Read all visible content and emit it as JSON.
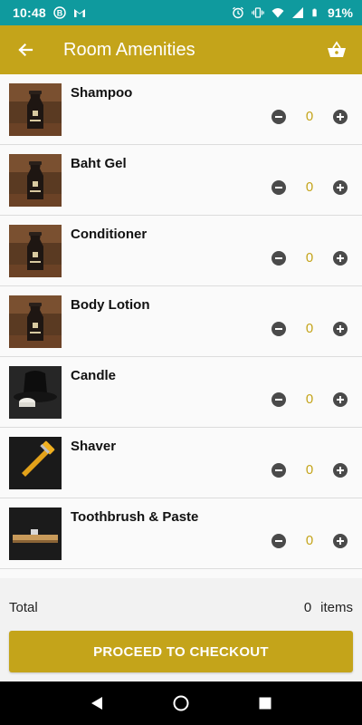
{
  "status_bar": {
    "time": "10:48",
    "battery": "91%",
    "left_icons": [
      "b-badge-icon",
      "gmail-icon"
    ],
    "right_icons": [
      "alarm-icon",
      "vibrate-icon",
      "wifi-icon",
      "signal-icon",
      "battery-icon"
    ]
  },
  "app_bar": {
    "title": "Room Amenities",
    "back_icon": "arrow-back-icon",
    "cart_icon": "basket-icon"
  },
  "items": [
    {
      "name": "Shampoo",
      "qty": "0",
      "thumb": "bottle"
    },
    {
      "name": "Baht Gel",
      "qty": "0",
      "thumb": "bottle"
    },
    {
      "name": "Conditioner",
      "qty": "0",
      "thumb": "bottle"
    },
    {
      "name": "Body Lotion",
      "qty": "0",
      "thumb": "bottle"
    },
    {
      "name": "Candle",
      "qty": "0",
      "thumb": "candle"
    },
    {
      "name": "Shaver",
      "qty": "0",
      "thumb": "shaver"
    },
    {
      "name": "Toothbrush & Paste",
      "qty": "0",
      "thumb": "toothbrush"
    }
  ],
  "footer": {
    "total_label": "Total",
    "total_count": "0",
    "items_label": "items",
    "checkout_label": "PROCEED TO CHECKOUT"
  },
  "colors": {
    "status_bar": "#0f9a9e",
    "accent": "#c4a41a",
    "qty_text": "#c4a41a",
    "stepper": "#4a4a4a"
  }
}
